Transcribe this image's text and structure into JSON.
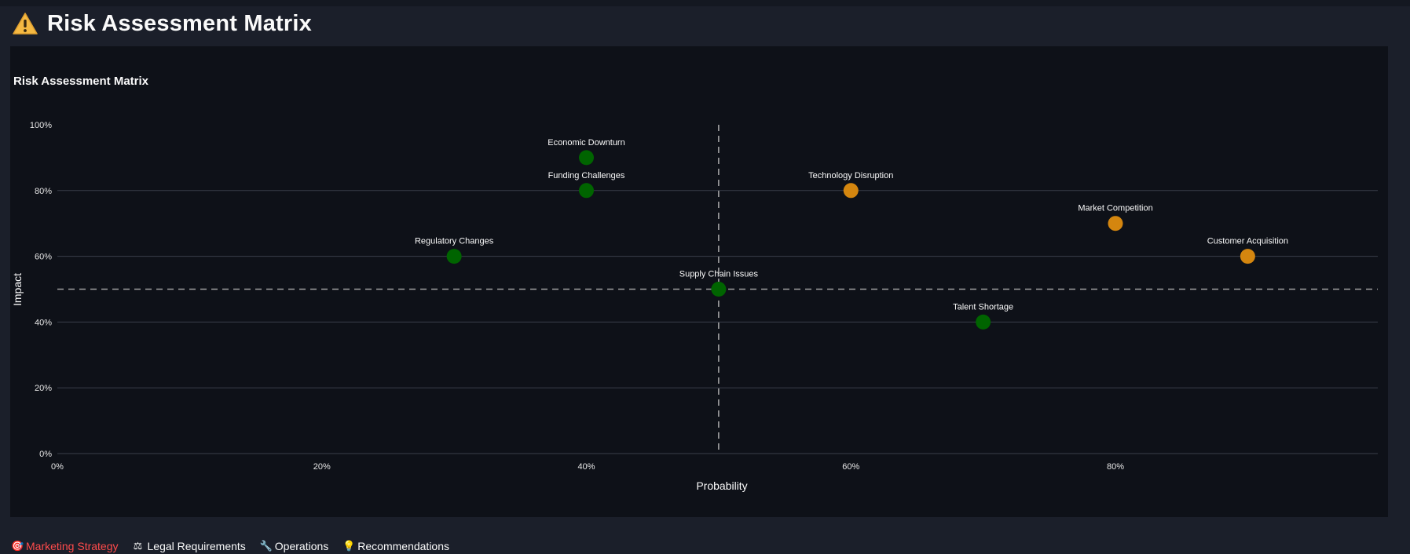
{
  "page": {
    "title": "Risk Assessment Matrix",
    "title_icon": "warning-icon"
  },
  "colors": {
    "background": "#1b1f2a",
    "card": "#0e1118",
    "low_risk": "#006400",
    "high_risk": "#d4860f",
    "grid": "#3a3f4a",
    "reference_line": "#a0a0a0",
    "active_tab": "#ff4b4b"
  },
  "chart_data": {
    "type": "scatter",
    "title": "Risk Assessment Matrix",
    "xlabel": "Probability",
    "ylabel": "Impact",
    "xlim": [
      0,
      1
    ],
    "ylim": [
      0,
      1
    ],
    "x_ticks": [
      "0%",
      "20%",
      "40%",
      "60%",
      "80%"
    ],
    "y_ticks": [
      "0%",
      "20%",
      "40%",
      "60%",
      "80%",
      "100%"
    ],
    "x_tick_values": [
      0,
      0.2,
      0.4,
      0.6,
      0.8
    ],
    "y_tick_values": [
      0,
      0.2,
      0.4,
      0.6,
      0.8,
      1.0
    ],
    "reference_lines": {
      "x": 0.5,
      "y": 0.5
    },
    "grid": true,
    "points": [
      {
        "label": "Economic Downturn",
        "x": 0.4,
        "y": 0.9,
        "color": "#006400"
      },
      {
        "label": "Funding Challenges",
        "x": 0.4,
        "y": 0.8,
        "color": "#006400"
      },
      {
        "label": "Technology Disruption",
        "x": 0.6,
        "y": 0.8,
        "color": "#d4860f"
      },
      {
        "label": "Market Competition",
        "x": 0.8,
        "y": 0.7,
        "color": "#d4860f"
      },
      {
        "label": "Regulatory Changes",
        "x": 0.3,
        "y": 0.6,
        "color": "#006400"
      },
      {
        "label": "Customer Acquisition",
        "x": 0.9,
        "y": 0.6,
        "color": "#d4860f"
      },
      {
        "label": "Supply Chain Issues",
        "x": 0.5,
        "y": 0.5,
        "color": "#006400"
      },
      {
        "label": "Talent Shortage",
        "x": 0.7,
        "y": 0.4,
        "color": "#006400"
      }
    ]
  },
  "tabs": [
    {
      "label": "Marketing Strategy",
      "icon": "target-icon",
      "glyph": "🎯",
      "active": true
    },
    {
      "label": "Legal Requirements",
      "icon": "scales-icon",
      "glyph": "⚖",
      "active": false
    },
    {
      "label": "Operations",
      "icon": "wrench-icon",
      "glyph": "🔧",
      "active": false
    },
    {
      "label": "Recommendations",
      "icon": "lightbulb-icon",
      "glyph": "💡",
      "active": false
    }
  ]
}
